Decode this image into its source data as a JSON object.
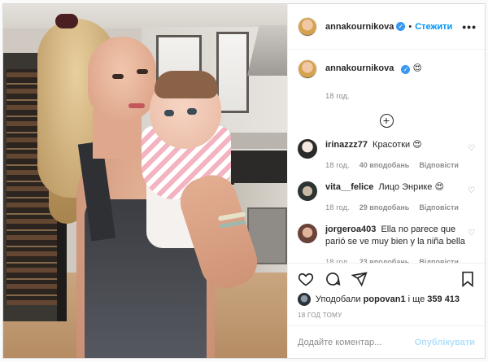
{
  "post": {
    "username": "annakournikova",
    "verified_mark": "✓",
    "follow_label": "Стежити",
    "more_label": "•••",
    "caption_emoji": "😍",
    "caption_time": "18 год.",
    "load_more_symbol": "+"
  },
  "comments": [
    {
      "user": "irinazzz77",
      "text": "Красотки 😍",
      "time": "18 год.",
      "likes": "40 вподобань",
      "reply_label": "Відповісти"
    },
    {
      "user": "vita__felice",
      "text": "Лицо Энрике 😍",
      "time": "18 год.",
      "likes": "29 вподобань",
      "reply_label": "Відповісти"
    },
    {
      "user": "jorgeroa403",
      "text": "Ella no parece que parió se ve muy bien y la niña bella",
      "time": "18 год.",
      "likes": "23 вподобань",
      "reply_label": "Відповісти"
    }
  ],
  "actions": {
    "liked_prefix": "Уподобали",
    "liked_user": "popovan1",
    "liked_mid": "і ще",
    "liked_count": "359 413",
    "time_ago": "18 ГОД ТОМУ"
  },
  "comment_box": {
    "placeholder": "Додайте коментар...",
    "publish_label": "Опублікувати"
  },
  "icons": [
    "heart-icon",
    "comment-icon",
    "share-icon",
    "bookmark-icon",
    "more-icon",
    "verified-icon",
    "add-icon"
  ],
  "colors": {
    "accent": "#0095f6",
    "verified": "#3897f0",
    "muted": "#8e8e8e",
    "publish_disabled": "#b2dffc"
  }
}
